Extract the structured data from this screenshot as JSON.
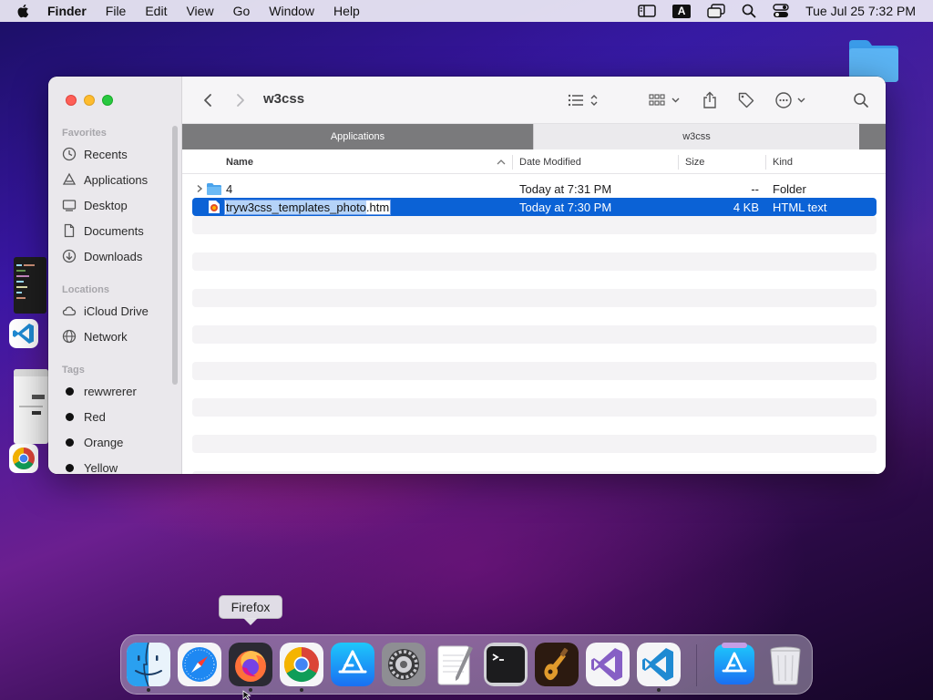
{
  "menubar": {
    "app": "Finder",
    "items": [
      "File",
      "Edit",
      "View",
      "Go",
      "Window",
      "Help"
    ],
    "input_source": "A",
    "clock": "Tue Jul 25  7:32 PM"
  },
  "finder": {
    "title": "w3css",
    "sidebar": {
      "favorites_label": "Favorites",
      "favorites": [
        "Recents",
        "Applications",
        "Desktop",
        "Documents",
        "Downloads"
      ],
      "locations_label": "Locations",
      "locations": [
        "iCloud Drive",
        "Network"
      ],
      "tags_label": "Tags",
      "tags": [
        {
          "label": "rewwrerer",
          "color": "#111111"
        },
        {
          "label": "Red",
          "color": "#111111"
        },
        {
          "label": "Orange",
          "color": "#111111"
        },
        {
          "label": "Yellow",
          "color": "#111111"
        }
      ]
    },
    "tabs": [
      "Applications",
      "w3css"
    ],
    "columns": {
      "name": "Name",
      "date": "Date Modified",
      "size": "Size",
      "kind": "Kind"
    },
    "rows": [
      {
        "name": "4",
        "date": "Today at 7:31 PM",
        "size": "--",
        "kind": "Folder"
      },
      {
        "name_base": "tryw3css_templates_photo",
        "name_ext": ".htm",
        "date": "Today at 7:30 PM",
        "size": "4 KB",
        "kind": "HTML text"
      }
    ]
  },
  "tooltip": "Firefox",
  "dock": {
    "apps": [
      "finder",
      "safari",
      "firefox",
      "chrome",
      "app-store",
      "system-settings",
      "textedit",
      "terminal",
      "garageband",
      "visual-studio",
      "vscode",
      "app-store-downloads",
      "trash"
    ]
  },
  "colors": {
    "selection": "#0b62d6",
    "accent": "#0b62d6"
  }
}
